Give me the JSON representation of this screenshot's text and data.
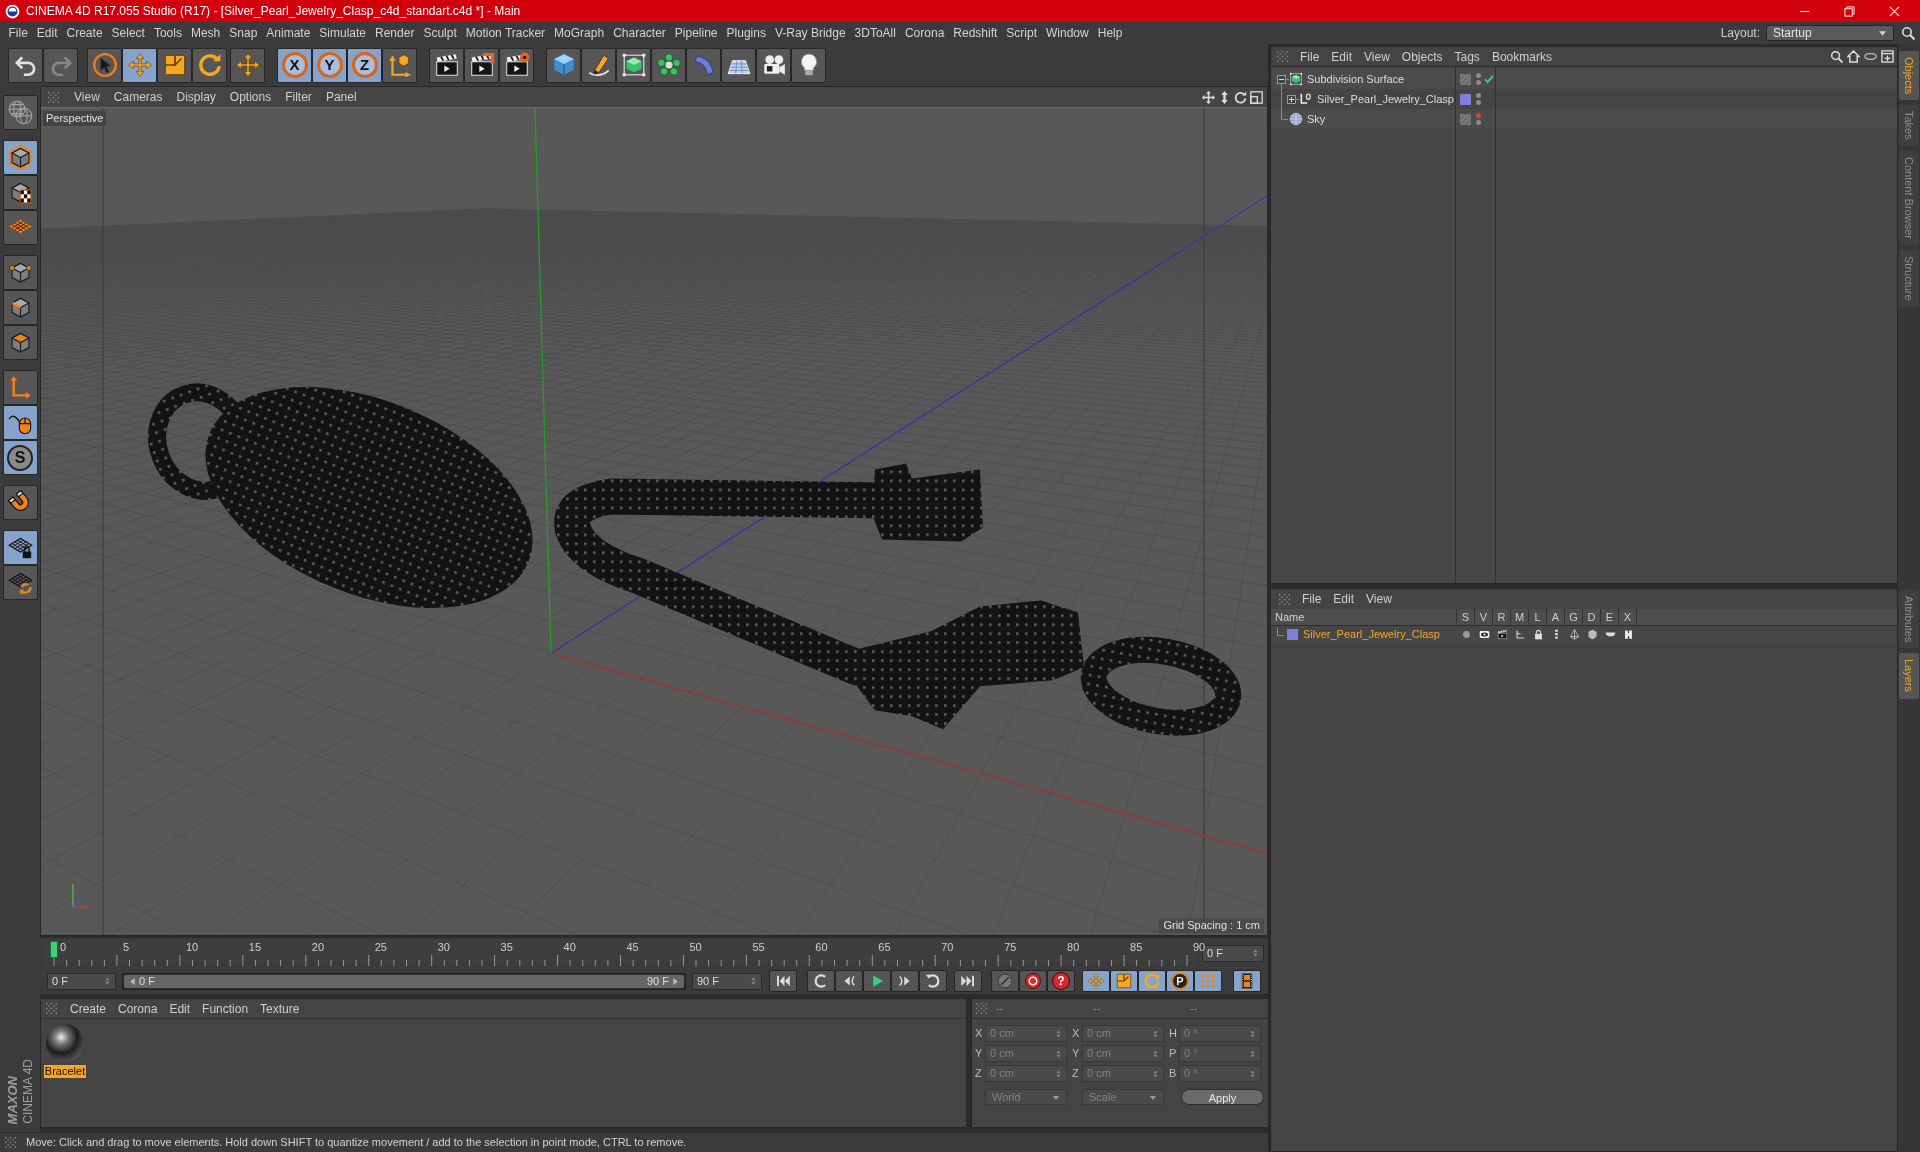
{
  "window": {
    "title": "CINEMA 4D R17.055 Studio (R17) - [Silver_Pearl_Jewelry_Clasp_c4d_standart.c4d *] - Main"
  },
  "menu_bar": {
    "items": [
      "File",
      "Edit",
      "Create",
      "Select",
      "Tools",
      "Mesh",
      "Snap",
      "Animate",
      "Simulate",
      "Render",
      "Sculpt",
      "Motion Tracker",
      "MoGraph",
      "Character",
      "Pipeline",
      "Plugins",
      "V-Ray Bridge",
      "3DToAll",
      "Corona",
      "Redshift",
      "Script",
      "Window",
      "Help"
    ],
    "layout_label": "Layout:",
    "layout_value": "Startup"
  },
  "toolbar": {
    "groups": [
      [
        {
          "kind": "undo",
          "selected": false,
          "disabled": false
        },
        {
          "kind": "redo",
          "selected": false,
          "disabled": true
        }
      ],
      [
        {
          "kind": "select",
          "selected": false,
          "disabled": false
        },
        {
          "kind": "move",
          "selected": true,
          "disabled": false
        },
        {
          "kind": "scale",
          "selected": false,
          "disabled": false
        },
        {
          "kind": "rotate",
          "selected": false,
          "disabled": false
        }
      ],
      [
        {
          "kind": "transform",
          "selected": false,
          "disabled": false
        }
      ],
      [
        {
          "kind": "axis-lock",
          "glyph": "X",
          "selected": true,
          "disabled": false
        },
        {
          "kind": "axis-lock",
          "glyph": "Y",
          "selected": true,
          "disabled": false
        },
        {
          "kind": "axis-lock",
          "glyph": "Z",
          "selected": true,
          "disabled": false
        },
        {
          "kind": "coordinate-system",
          "selected": false,
          "disabled": false
        }
      ],
      [
        {
          "kind": "render-view",
          "selected": false,
          "disabled": false
        },
        {
          "kind": "render-viewer",
          "selected": false,
          "disabled": false
        },
        {
          "kind": "render-settings",
          "selected": false,
          "disabled": false
        }
      ],
      [
        {
          "kind": "cube",
          "selected": false,
          "disabled": false
        },
        {
          "kind": "pen",
          "selected": false,
          "disabled": false
        },
        {
          "kind": "subdivision",
          "selected": false,
          "disabled": false
        },
        {
          "kind": "cloner",
          "selected": false,
          "disabled": false
        },
        {
          "kind": "bend",
          "selected": false,
          "disabled": false
        },
        {
          "kind": "floor",
          "selected": false,
          "disabled": false
        },
        {
          "kind": "camera",
          "selected": false,
          "disabled": false
        },
        {
          "kind": "light",
          "selected": false,
          "disabled": false
        }
      ]
    ]
  },
  "tool_palette": {
    "groups": [
      [
        {
          "kind": "make-editable",
          "selected": false
        }
      ],
      [
        {
          "kind": "model",
          "selected": true
        },
        {
          "kind": "texture",
          "selected": false
        },
        {
          "kind": "workplane",
          "selected": false
        }
      ],
      [
        {
          "kind": "points",
          "selected": false
        },
        {
          "kind": "edges",
          "selected": false
        },
        {
          "kind": "polygons",
          "selected": false
        }
      ],
      [
        {
          "kind": "axis",
          "selected": false
        },
        {
          "kind": "tweak",
          "selected": true
        },
        {
          "kind": "solo",
          "glyph": "S",
          "selected": true
        }
      ],
      [
        {
          "kind": "snap",
          "selected": false
        }
      ],
      [
        {
          "kind": "workplane-lock",
          "selected": true
        },
        {
          "kind": "workplane-snap",
          "selected": false
        }
      ]
    ]
  },
  "logo": {
    "brand": "MAXON",
    "product": "CINEMA 4D"
  },
  "viewport": {
    "menu": [
      "View",
      "Cameras",
      "Display",
      "Options",
      "Filter",
      "Panel"
    ],
    "camera": "Perspective",
    "grid_spacing": "Grid Spacing : 1 cm"
  },
  "timeline": {
    "ticks": [
      "0",
      "5",
      "10",
      "15",
      "20",
      "25",
      "30",
      "35",
      "40",
      "45",
      "50",
      "55",
      "60",
      "65",
      "70",
      "75",
      "80",
      "85",
      "90"
    ],
    "level": 0,
    "current_frame": "0 F"
  },
  "transport": {
    "start_frame": "0 F",
    "range_slider": {
      "start": "0 F",
      "end": "90 F",
      "level": 1
    },
    "end_frame": "90 F",
    "groups": [
      [
        {
          "kind": "go-start",
          "selected": false
        }
      ],
      [
        {
          "kind": "prev-key",
          "selected": false
        },
        {
          "kind": "prev-frame",
          "selected": false
        },
        {
          "kind": "play",
          "selected": false
        },
        {
          "kind": "next-frame",
          "selected": false
        },
        {
          "kind": "next-key",
          "selected": false
        }
      ],
      [
        {
          "kind": "go-end",
          "selected": false
        }
      ],
      [
        {
          "kind": "key-off",
          "selected": false
        },
        {
          "kind": "record",
          "selected": false
        },
        {
          "kind": "help",
          "glyph": "?",
          "selected": false
        }
      ],
      [
        {
          "kind": "key-position",
          "selected": true
        },
        {
          "kind": "key-scale",
          "selected": true
        },
        {
          "kind": "key-rotation",
          "selected": true
        },
        {
          "kind": "key-param",
          "glyph": "P",
          "selected": true
        },
        {
          "kind": "key-points",
          "selected": true
        }
      ],
      [
        {
          "kind": "timeline",
          "selected": true
        }
      ]
    ]
  },
  "material_manager": {
    "menu": [
      "Create",
      "Corona",
      "Edit",
      "Function",
      "Texture"
    ],
    "materials": [
      {
        "name": "Bracelet",
        "selected": true
      }
    ]
  },
  "coordinates": {
    "disabled": true,
    "headers": [
      "--",
      "--",
      "--"
    ],
    "rows": [
      {
        "cells": [
          {
            "label": "X",
            "value": "0 cm"
          },
          {
            "label": "X",
            "value": "0 cm"
          },
          {
            "label": "H",
            "value": "0 °"
          }
        ]
      },
      {
        "cells": [
          {
            "label": "Y",
            "value": "0 cm"
          },
          {
            "label": "Y",
            "value": "0 cm"
          },
          {
            "label": "P",
            "value": "0 °"
          }
        ]
      },
      {
        "cells": [
          {
            "label": "Z",
            "value": "0 cm"
          },
          {
            "label": "Z",
            "value": "0 cm"
          },
          {
            "label": "B",
            "value": "0 °"
          }
        ]
      }
    ],
    "dropdowns": [
      "World",
      "Scale"
    ],
    "apply": "Apply"
  },
  "status_bar": {
    "text": "Move: Click and drag to move elements. Hold down SHIFT to quantize movement / add to the selection in point mode, CTRL to remove."
  },
  "object_manager": {
    "menu": [
      "File",
      "Edit",
      "View",
      "Objects",
      "Tags",
      "Bookmarks"
    ],
    "objects": [
      {
        "kind": "subdivision",
        "name": "Subdivision Surface",
        "expanded": true,
        "enabled": true,
        "dots": [
          {
            "color": "#8c8c8c"
          },
          {
            "color": "#8c8c8c"
          }
        ],
        "children": [
          {
            "kind": "null",
            "name": "Silver_Pearl_Jewelry_Clasp",
            "expanded": false,
            "layer": {
              "color": "#8080d8"
            },
            "dots": [
              {
                "color": "#8c8c8c"
              },
              {
                "color": "#8c8c8c"
              }
            ]
          }
        ]
      },
      {
        "kind": "sky",
        "name": "Sky",
        "dots": [
          {
            "color": "#e04040"
          },
          {
            "color": "#8c8c8c"
          }
        ]
      }
    ]
  },
  "layer_manager": {
    "menu": [
      "File",
      "Edit",
      "View"
    ],
    "columns": [
      "Name",
      "S",
      "V",
      "R",
      "M",
      "L",
      "A",
      "G",
      "D",
      "E",
      "X"
    ],
    "layers": [
      {
        "name": "Silver_Pearl_Jewelry_Clasp",
        "color": "#8080d8"
      }
    ]
  },
  "side_tabs": {
    "upper": [
      {
        "label": "Objects",
        "selected": true
      },
      {
        "label": "Takes",
        "selected": false
      },
      {
        "label": "Content Browser",
        "selected": false
      },
      {
        "label": "Structure",
        "selected": false
      }
    ],
    "lower": [
      {
        "label": "Attributes",
        "selected": false
      },
      {
        "label": "Layers",
        "selected": true
      }
    ]
  }
}
